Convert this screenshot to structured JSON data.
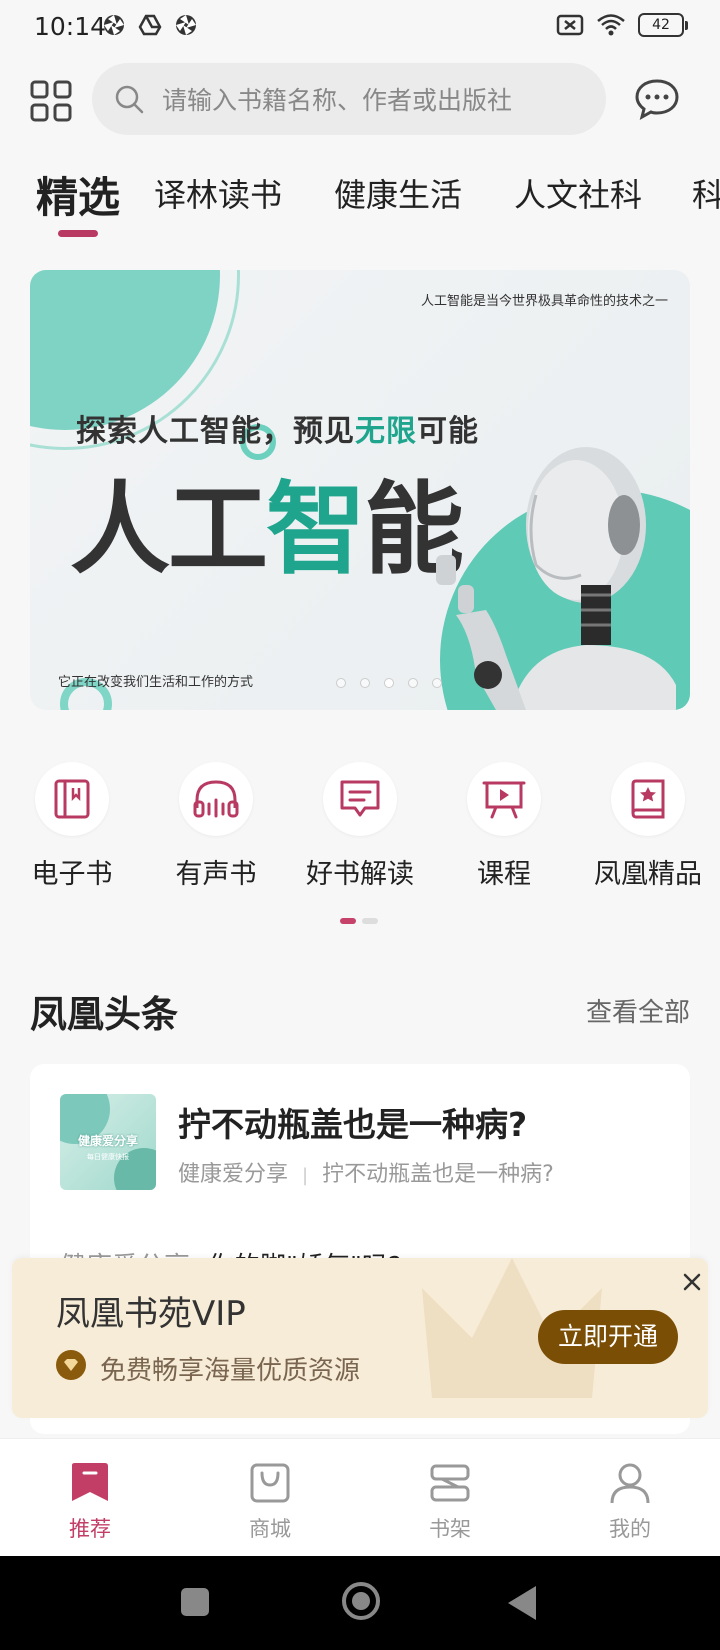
{
  "status_bar": {
    "time": "10:14",
    "battery": "42"
  },
  "search": {
    "placeholder": "请输入书籍名称、作者或出版社"
  },
  "tabs": [
    {
      "label": "精选",
      "active": true
    },
    {
      "label": "译林读书"
    },
    {
      "label": "健康生活"
    },
    {
      "label": "人文社科"
    },
    {
      "label": "科"
    }
  ],
  "banner": {
    "top_line": "人工智能是当今世界极具革命性的技术之一",
    "subtitle_a": "探索人工智能，预见",
    "subtitle_hl": "无限",
    "subtitle_b": "可能",
    "title_a": "人工",
    "title_hl": "智",
    "title_b": "能",
    "bottom_line": "它正在改变我们生活和工作的方式"
  },
  "quick_links": [
    {
      "label": "电子书",
      "icon": "ebook-icon"
    },
    {
      "label": "有声书",
      "icon": "headphones-icon"
    },
    {
      "label": "好书解读",
      "icon": "message-interpret-icon"
    },
    {
      "label": "课程",
      "icon": "course-board-icon"
    },
    {
      "label": "凤凰精品",
      "icon": "star-book-icon"
    }
  ],
  "section": {
    "title": "凤凰头条",
    "view_all": "查看全部"
  },
  "headlines": {
    "thumb_title": "健康爱分享",
    "thumb_sub": "每日健康快报",
    "item1_title": "拧不动瓶盖也是一种病?",
    "item1_source": "健康爱分享",
    "item1_summary": "拧不动瓶盖也是一种病?",
    "item2_source": "健康爱分享",
    "item2_title": "你的脚\"娇气\"吗?"
  },
  "vip": {
    "title": "凤凰书苑VIP",
    "desc": "免费畅享海量优质资源",
    "button": "立即开通"
  },
  "bottom_nav": [
    {
      "label": "推荐",
      "icon": "recommend-bookmark-icon",
      "active": true
    },
    {
      "label": "商城",
      "icon": "shopping-bag-icon"
    },
    {
      "label": "书架",
      "icon": "bookshelf-icon"
    },
    {
      "label": "我的",
      "icon": "profile-icon"
    }
  ],
  "colors": {
    "accent": "#c23e66",
    "banner_green": "#1fa58d",
    "vip_button": "#7a4e05",
    "vip_bg": "#f7ecd7"
  }
}
